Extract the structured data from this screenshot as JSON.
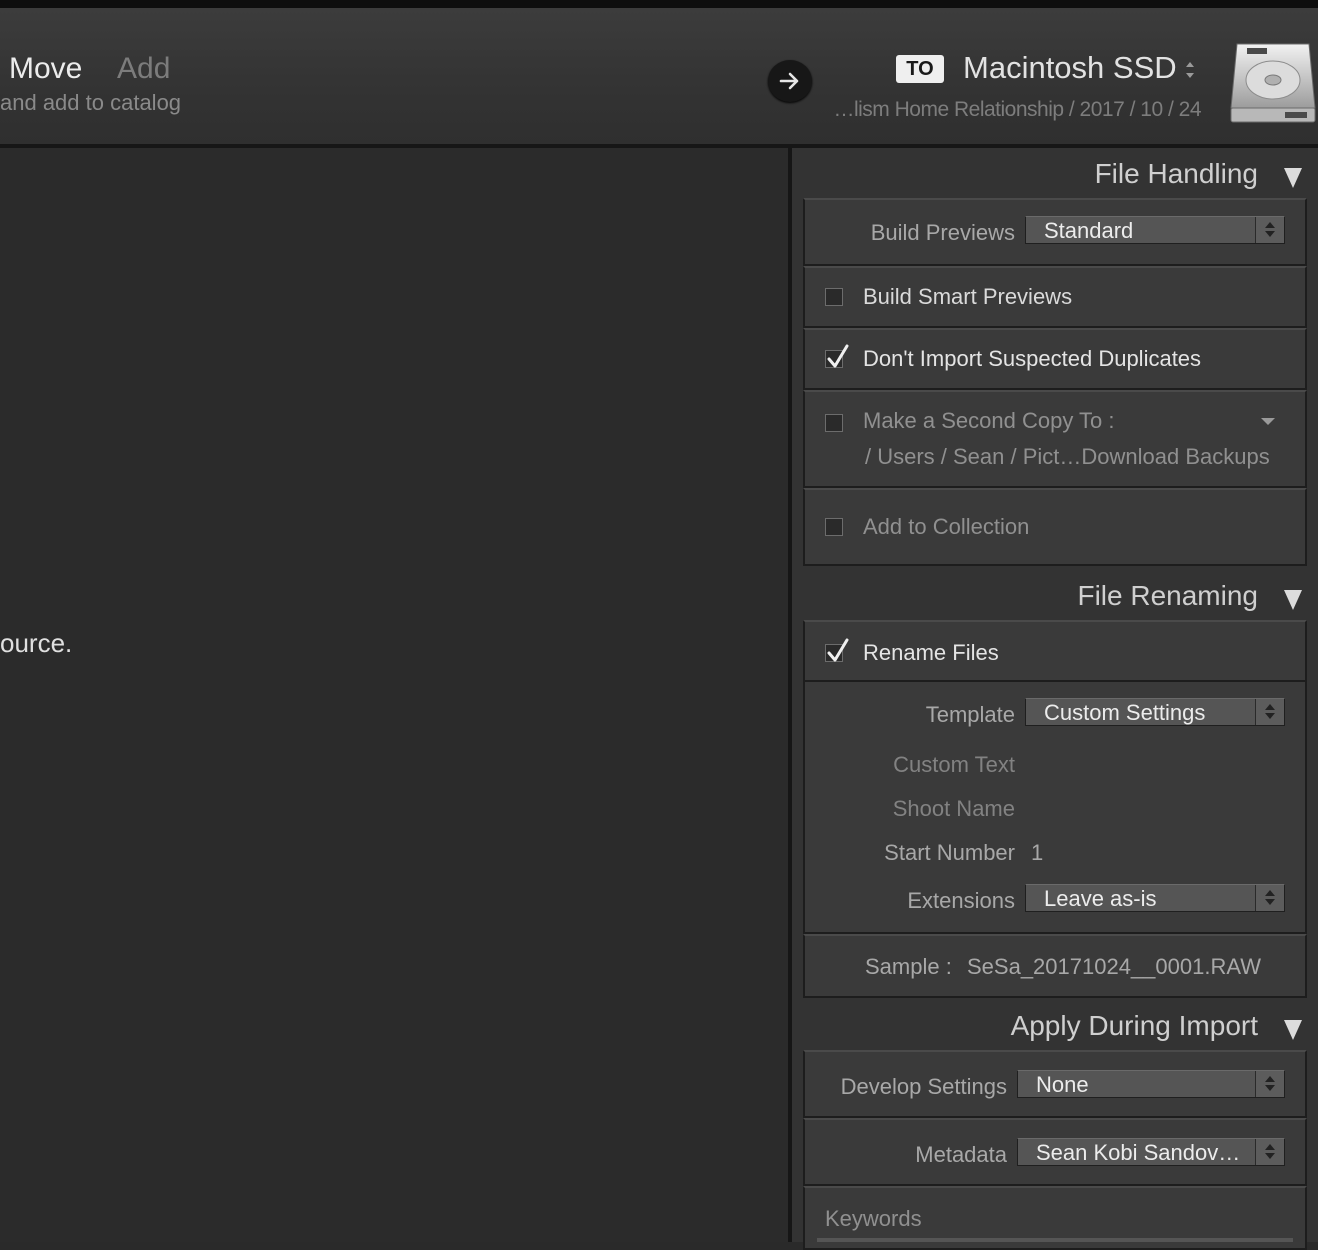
{
  "header": {
    "mode_move": "Move",
    "mode_add": "Add",
    "mode_description": "and add to catalog",
    "to_badge": "TO",
    "destination_name": "Macintosh SSD",
    "destination_path": "…lism Home Relationship / 2017 / 10 / 24",
    "drive_icon": "hard-drive-icon",
    "arrow_icon": "arrow-right-icon"
  },
  "left_panel": {
    "message_fragment": "ource."
  },
  "file_handling": {
    "title": "File Handling",
    "build_previews_label": "Build Previews",
    "build_previews_value": "Standard",
    "build_smart_previews": {
      "label": "Build Smart Previews",
      "checked": false
    },
    "dont_import_duplicates": {
      "label": "Don't Import Suspected Duplicates",
      "checked": true
    },
    "second_copy": {
      "label": "Make a Second Copy To :",
      "checked": false,
      "path": "/ Users / Sean / Pict…Download Backups"
    },
    "add_to_collection": {
      "label": "Add to Collection",
      "checked": false
    }
  },
  "file_renaming": {
    "title": "File Renaming",
    "rename_files": {
      "label": "Rename Files",
      "checked": true
    },
    "template_label": "Template",
    "template_value": "Custom Settings",
    "custom_text_label": "Custom Text",
    "shoot_name_label": "Shoot Name",
    "start_number_label": "Start Number",
    "start_number_value": "1",
    "extensions_label": "Extensions",
    "extensions_value": "Leave as-is",
    "sample_label": "Sample :",
    "sample_value": "SeSa_20171024__0001.RAW"
  },
  "apply_during_import": {
    "title": "Apply During Import",
    "develop_settings_label": "Develop Settings",
    "develop_settings_value": "None",
    "metadata_label": "Metadata",
    "metadata_value": "Sean Kobi Sandov…",
    "keywords_label": "Keywords"
  }
}
